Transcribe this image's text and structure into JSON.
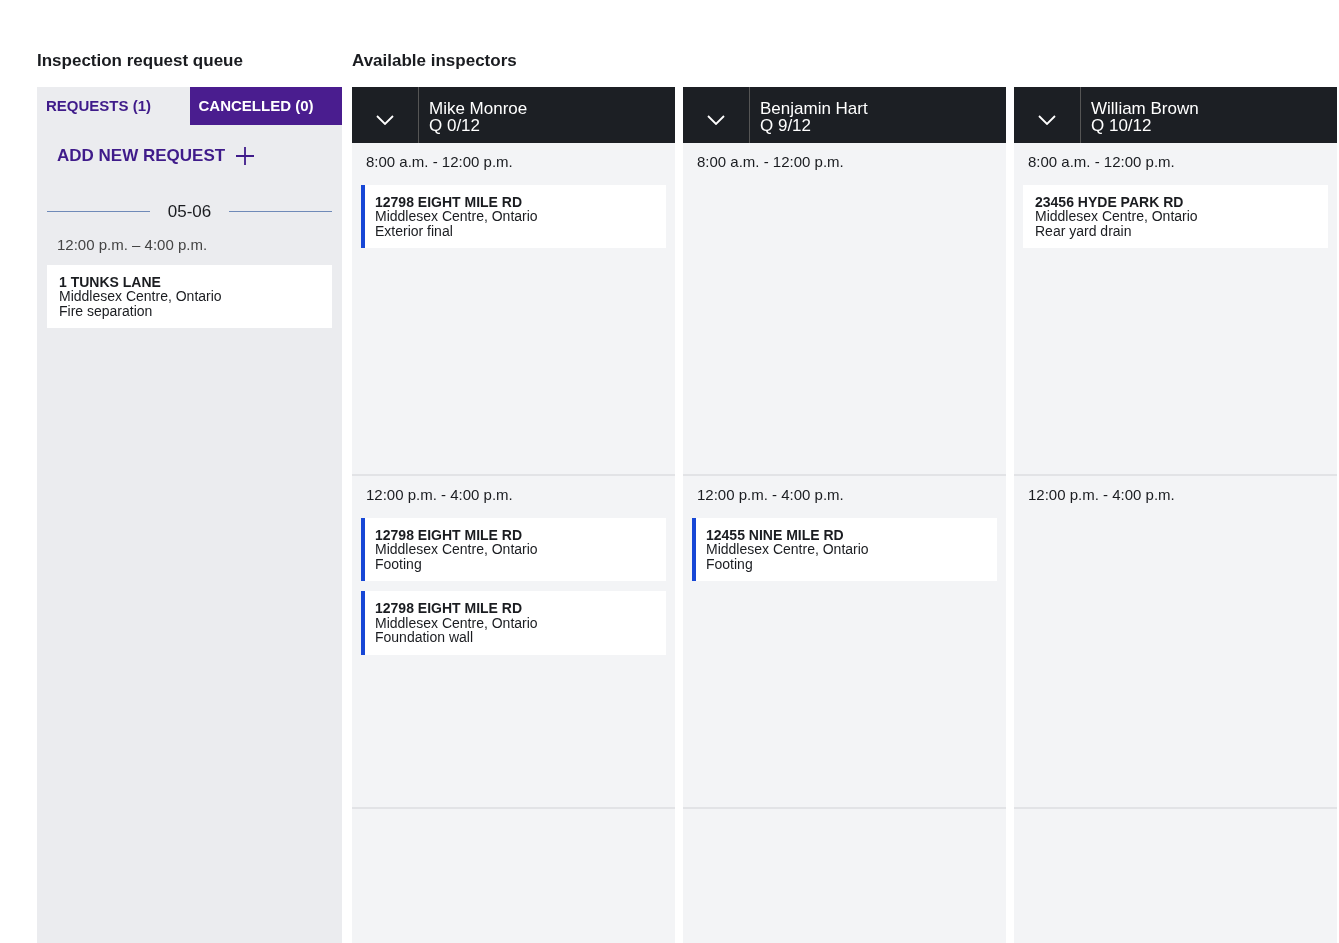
{
  "queue": {
    "title": "Inspection request queue",
    "tabs": [
      {
        "label": "REQUESTS (1)",
        "selected": true
      },
      {
        "label": "CANCELLED (0)",
        "selected": false
      }
    ],
    "add_button": "ADD NEW REQUEST",
    "date": "05-06",
    "slot": "12:00 p.m. – 4:00 p.m.",
    "requests": [
      {
        "address": "1 TUNKS LANE",
        "city": "Middlesex Centre, Ontario",
        "type": "Fire separation"
      }
    ]
  },
  "inspectors_title": "Available inspectors",
  "inspectors": [
    {
      "name": "Mike Monroe",
      "quota": "Q 0/12",
      "slots": [
        {
          "label": "8:00 a.m. - 12:00 p.m.",
          "bookings": [
            {
              "address": "12798 EIGHT MILE RD",
              "city": "Middlesex Centre, Ontario",
              "type": "Exterior final",
              "marked": true
            }
          ]
        },
        {
          "label": "12:00 p.m. - 4:00 p.m.",
          "bookings": [
            {
              "address": "12798 EIGHT MILE RD",
              "city": "Middlesex Centre, Ontario",
              "type": "Footing",
              "marked": true
            },
            {
              "address": "12798 EIGHT MILE RD",
              "city": "Middlesex Centre, Ontario",
              "type": "Foundation wall",
              "marked": true
            }
          ]
        }
      ]
    },
    {
      "name": "Benjamin Hart",
      "quota": "Q 9/12",
      "slots": [
        {
          "label": "8:00 a.m. - 12:00 p.m."
        },
        {
          "label": "12:00 p.m. - 4:00 p.m.",
          "bookings": [
            {
              "address": "12455 NINE MILE RD",
              "city": "Middlesex Centre, Ontario",
              "type": "Footing",
              "marked": true
            }
          ]
        }
      ]
    },
    {
      "name": "William Brown",
      "quota": "Q 10/12",
      "slots": [
        {
          "label": "8:00 a.m. - 12:00 p.m.",
          "bookings": [
            {
              "address": "23456 HYDE PARK RD",
              "city": "Middlesex Centre, Ontario",
              "type": "Rear yard drain",
              "marked": false
            }
          ]
        },
        {
          "label": "12:00 p.m. - 4:00 p.m."
        }
      ]
    }
  ]
}
